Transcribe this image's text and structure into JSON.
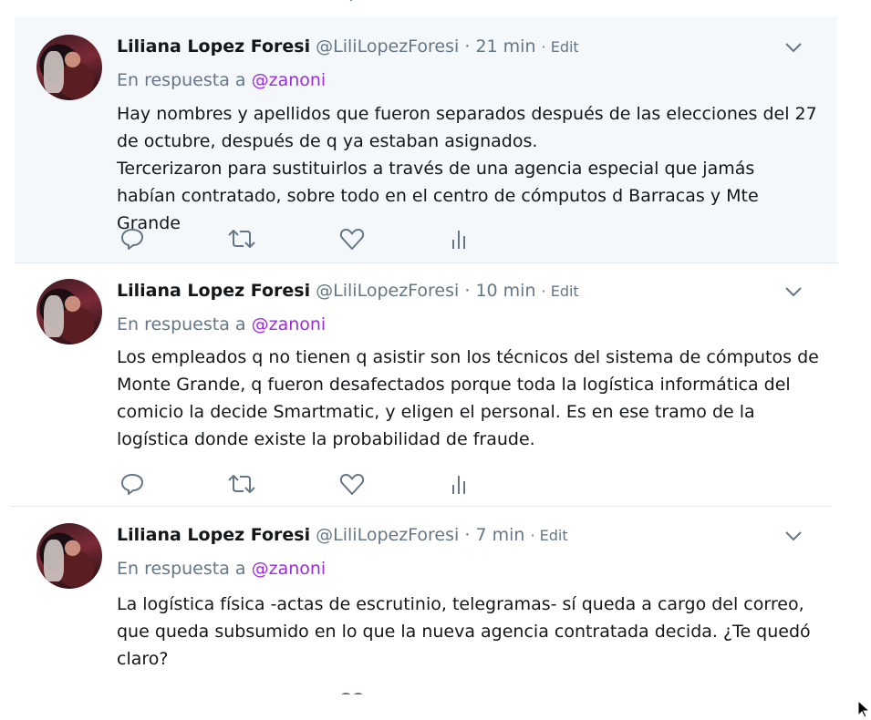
{
  "tweets": [
    {
      "name": "Liliana Lopez Foresi",
      "handle": "@LiliLopezForesi",
      "sep": "·",
      "time": "21 min",
      "edit": "· Edit",
      "reply_prefix": "En respuesta a",
      "reply_to": "@zanoni",
      "text": [
        "Hay nombres y apellidos que fueron separados después de las elecciones del 27 de octubre, después de q ya estaban asignados.",
        "Tercerizaron para sustituirlos a través de una agencia especial que jamás habían contratado, sobre todo en el centro de cómputos d Barracas y Mte Grande"
      ],
      "highlighted": true
    },
    {
      "name": "Liliana Lopez Foresi",
      "handle": "@LiliLopezForesi",
      "sep": "·",
      "time": "10 min",
      "edit": "· Edit",
      "reply_prefix": "En respuesta a",
      "reply_to": "@zanoni",
      "text": [
        "Los empleados q no tienen q asistir son los técnicos del sistema de cómputos de Monte Grande, q fueron desafectados porque toda la logística informática del comicio la decide Smartmatic, y eligen el personal. Es en ese tramo de la logística donde existe la probabilidad de fraude."
      ],
      "highlighted": false
    },
    {
      "name": "Liliana Lopez Foresi",
      "handle": "@LiliLopezForesi",
      "sep": "·",
      "time": "7 min",
      "edit": "· Edit",
      "reply_prefix": "En respuesta a",
      "reply_to": "@zanoni",
      "text": [
        "La logística física -actas de escrutinio, telegramas- sí queda a cargo del correo, que queda subsumido en lo que la nueva agencia contratada decida. ¿Te quedó claro?"
      ],
      "highlighted": false
    }
  ],
  "icons": {
    "reply": "reply-icon",
    "retweet": "retweet-icon",
    "like": "heart-icon",
    "analytics": "analytics-icon",
    "more": "chevron-down-icon"
  },
  "colors": {
    "mention": "#9a2de0",
    "muted": "#657786",
    "highlight_bg": "#f5f8fa"
  }
}
